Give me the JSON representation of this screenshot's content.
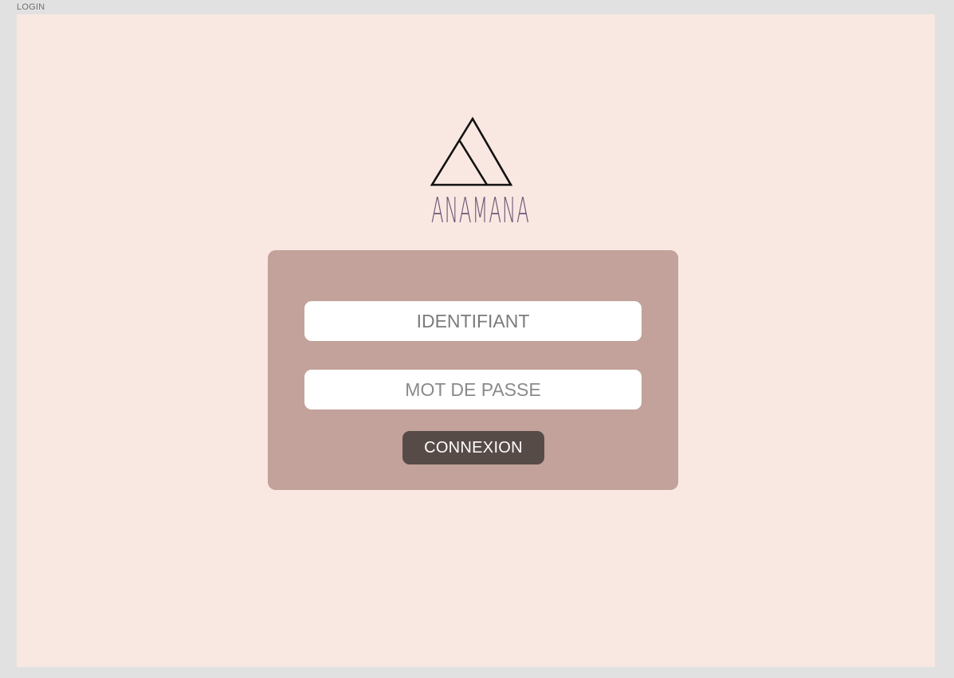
{
  "frame": {
    "label": "LOGIN"
  },
  "brand": {
    "name": "ANAMANA",
    "logo_icon": "triangle-mountain-icon",
    "text_color": "#6e5a78"
  },
  "login_form": {
    "username": {
      "placeholder": "IDENTIFIANT",
      "value": ""
    },
    "password": {
      "placeholder": "MOT DE PASSE",
      "value": ""
    },
    "submit_label": "CONNEXION"
  },
  "colors": {
    "canvas": "#e1e1e1",
    "artboard": "#f9e8e2",
    "card": "#c2a29a",
    "button": "#574b48",
    "field": "#ffffff"
  }
}
